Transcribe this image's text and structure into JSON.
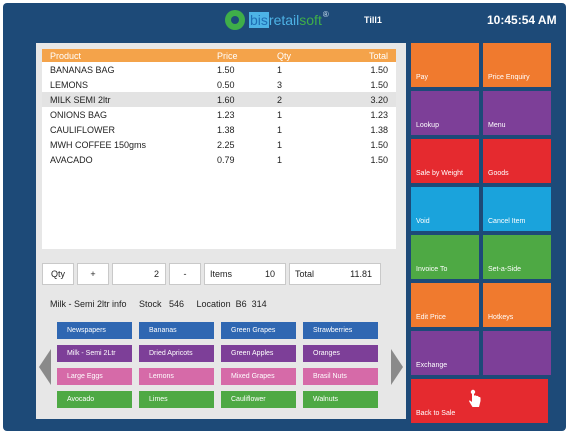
{
  "header": {
    "logo_part1": "bis",
    "logo_part2": "retail",
    "logo_part3": "soft",
    "logo_reg": "®",
    "till": "Till1",
    "time": "10:45:54 AM"
  },
  "grid": {
    "columns": [
      "Product",
      "Price",
      "Qty",
      "Total"
    ],
    "rows": [
      {
        "product": "BANANAS BAG",
        "price": "1.50",
        "qty": "1",
        "total": "1.50"
      },
      {
        "product": "LEMONS",
        "price": "0.50",
        "qty": "3",
        "total": "1.50"
      },
      {
        "product": "MILK SEMI 2ltr",
        "price": "1.60",
        "qty": "2",
        "total": "3.20"
      },
      {
        "product": "ONIONS BAG",
        "price": "1.23",
        "qty": "1",
        "total": "1.23"
      },
      {
        "product": "CAULIFLOWER",
        "price": "1.38",
        "qty": "1",
        "total": "1.38"
      },
      {
        "product": "MWH COFFEE 150gms",
        "price": "2.25",
        "qty": "1",
        "total": "1.50"
      },
      {
        "product": "AVACADO",
        "price": "0.79",
        "qty": "1",
        "total": "1.50"
      }
    ]
  },
  "qtybar": {
    "qty_label": "Qty",
    "plus": "+",
    "qty_value": "2",
    "minus": "-",
    "items_label": "Items",
    "items_value": "10",
    "total_label": "Total",
    "total_value": "11.81"
  },
  "info": {
    "text": "Milk - Semi 2ltr info     Stock   546     Location  B6  314"
  },
  "quick_keys": [
    {
      "label": "Newspapers",
      "color": "#2f67b2"
    },
    {
      "label": "Bananas",
      "color": "#2f67b2"
    },
    {
      "label": "Green Grapes",
      "color": "#2f67b2"
    },
    {
      "label": "Strawberries",
      "color": "#2f67b2"
    },
    {
      "label": "Milk - Semi 2Ltr",
      "color": "#7d3f98"
    },
    {
      "label": "Dried Apricots",
      "color": "#7d3f98"
    },
    {
      "label": "Green Apples",
      "color": "#7d3f98"
    },
    {
      "label": "Oranges",
      "color": "#7d3f98"
    },
    {
      "label": "Large Eggs",
      "color": "#d66aa8"
    },
    {
      "label": "Lemons",
      "color": "#d66aa8"
    },
    {
      "label": "Mixed Grapes",
      "color": "#d66aa8"
    },
    {
      "label": "Brasil Nuts",
      "color": "#d66aa8"
    },
    {
      "label": "Avocado",
      "color": "#4ea944"
    },
    {
      "label": "Limes",
      "color": "#4ea944"
    },
    {
      "label": "Cauliflower",
      "color": "#4ea944"
    },
    {
      "label": "Walnuts",
      "color": "#4ea944"
    }
  ],
  "function_keys": [
    {
      "label": "Pay",
      "color": "#f07a2e"
    },
    {
      "label": "Price Enquiry",
      "color": "#f07a2e"
    },
    {
      "label": "Lookup",
      "color": "#7d3f98"
    },
    {
      "label": "Menu",
      "color": "#7d3f98"
    },
    {
      "label": "Sale by Weight",
      "color": "#e52a2f"
    },
    {
      "label": "Goods",
      "color": "#e52a2f"
    },
    {
      "label": "Void",
      "color": "#1aa3dc"
    },
    {
      "label": "Cancel Item",
      "color": "#1aa3dc"
    },
    {
      "label": "Invoice To",
      "color": "#4ea944"
    },
    {
      "label": "Set-a-Side",
      "color": "#4ea944"
    },
    {
      "label": "Edit Price",
      "color": "#f07a2e"
    },
    {
      "label": "Hotkeys",
      "color": "#f07a2e"
    },
    {
      "label": "Exchange",
      "color": "#7d3f98"
    },
    {
      "label": "",
      "color": "#7d3f98"
    },
    {
      "label": "Back to Sale",
      "color": "#e52a2f"
    }
  ],
  "colors": {
    "background": "#1d4a78",
    "grid_header": "#f4a34a",
    "selected_row": "#e3e3e3",
    "panel": "#e7e7e7"
  }
}
